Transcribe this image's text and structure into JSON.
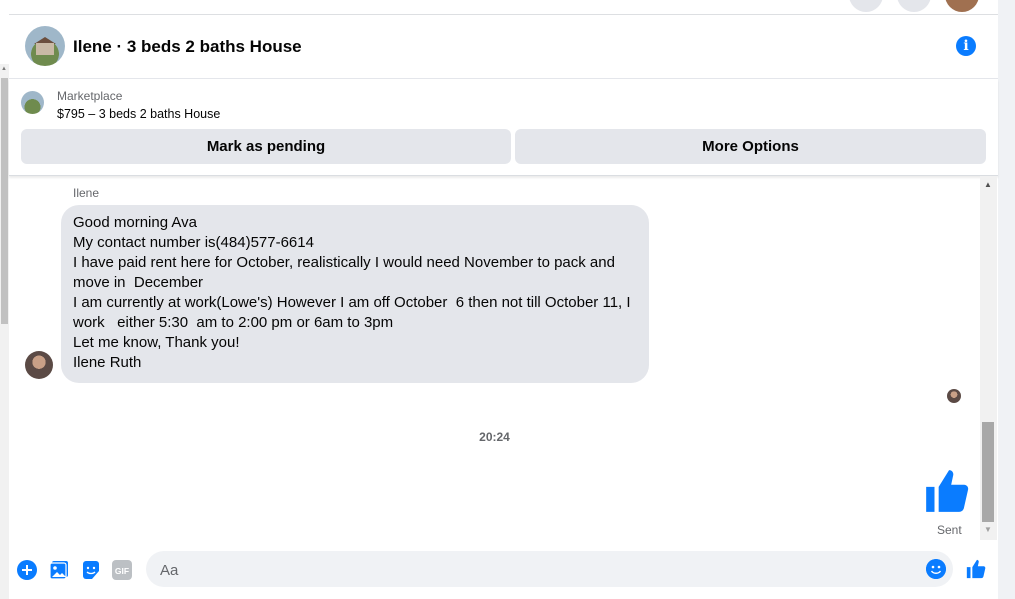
{
  "header": {
    "title": "Ilene · 3 beds 2 baths House",
    "info_icon": "i"
  },
  "listing": {
    "label": "Marketplace",
    "price": "$795 – 3 beds 2 baths House",
    "buttons": {
      "mark_pending": "Mark as pending",
      "more_options": "More Options"
    }
  },
  "messages": {
    "sender_name": "Ilene",
    "lines": [
      "Good morning Ava",
      "My contact number is(484)577-6614",
      "I have paid rent here for October, realistically I would need November to pack and move in  December",
      "I am currently at work(Lowe's) However I am off October  6 then not till October 11, I work   either 5:30  am to 2:00 pm or 6am to 3pm",
      "Let me know, Thank you!",
      "Ilene Ruth"
    ],
    "timestamp": "20:24",
    "status": "Sent"
  },
  "composer": {
    "placeholder": "Aa",
    "gif_label": "GIF"
  },
  "colors": {
    "accent": "#0a7cff",
    "bubble": "#e4e6eb"
  }
}
